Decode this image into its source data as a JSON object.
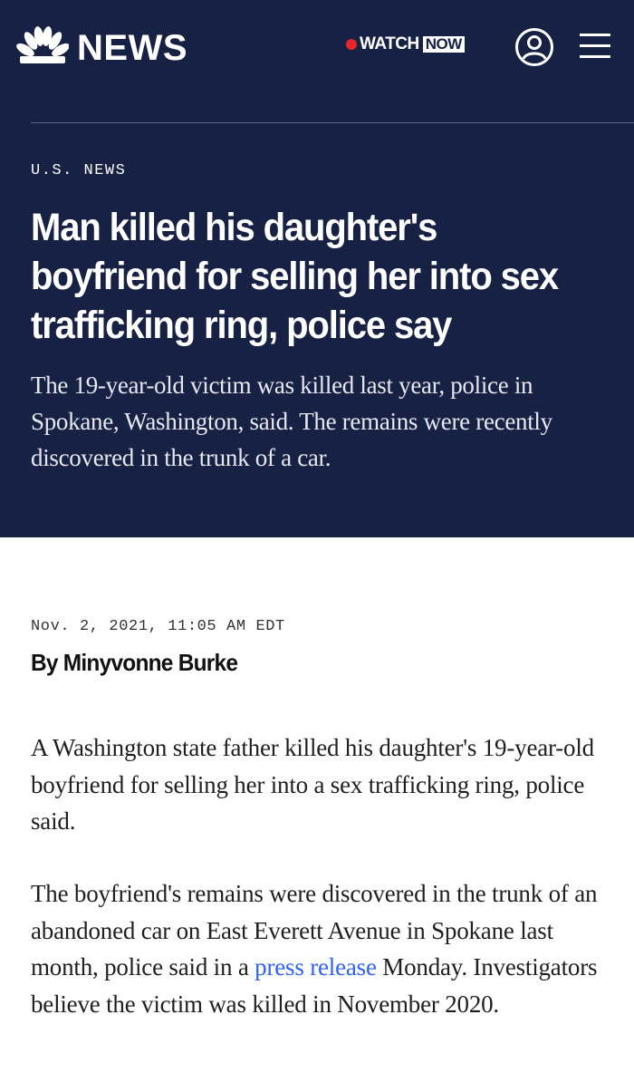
{
  "header": {
    "logo_text": "NEWS",
    "logo_icon": "peacock-icon",
    "watch_label": "WATCH",
    "watch_now": "NOW",
    "live_color": "#e3272a",
    "account_icon": "account-icon",
    "menu_icon": "hamburger-menu-icon"
  },
  "colors": {
    "hero_background": "#172144",
    "link": "#3061ff"
  },
  "article": {
    "section": "U.S. NEWS",
    "headline": "Man killed his daughter's boyfriend for selling her into sex trafficking ring, police say",
    "dek": "The 19-year-old victim was killed last year, police in Spokane, Washington, said. The remains were recently discovered in the trunk of a car.",
    "date": "Nov. 2, 2021, 11:05 AM EDT",
    "byline": "By Minyvonne Burke",
    "paragraph1": "A Washington state father killed his daughter's 19-year-old boyfriend for selling her into a sex trafficking ring, police said.",
    "paragraph2_before": "The boyfriend's remains were discovered in the trunk of an abandoned car on East Everett Avenue in Spokane last month, police said in a ",
    "paragraph2_link": "press release",
    "paragraph2_after": " Monday. Investigators believe the victim was killed in November 2020."
  }
}
